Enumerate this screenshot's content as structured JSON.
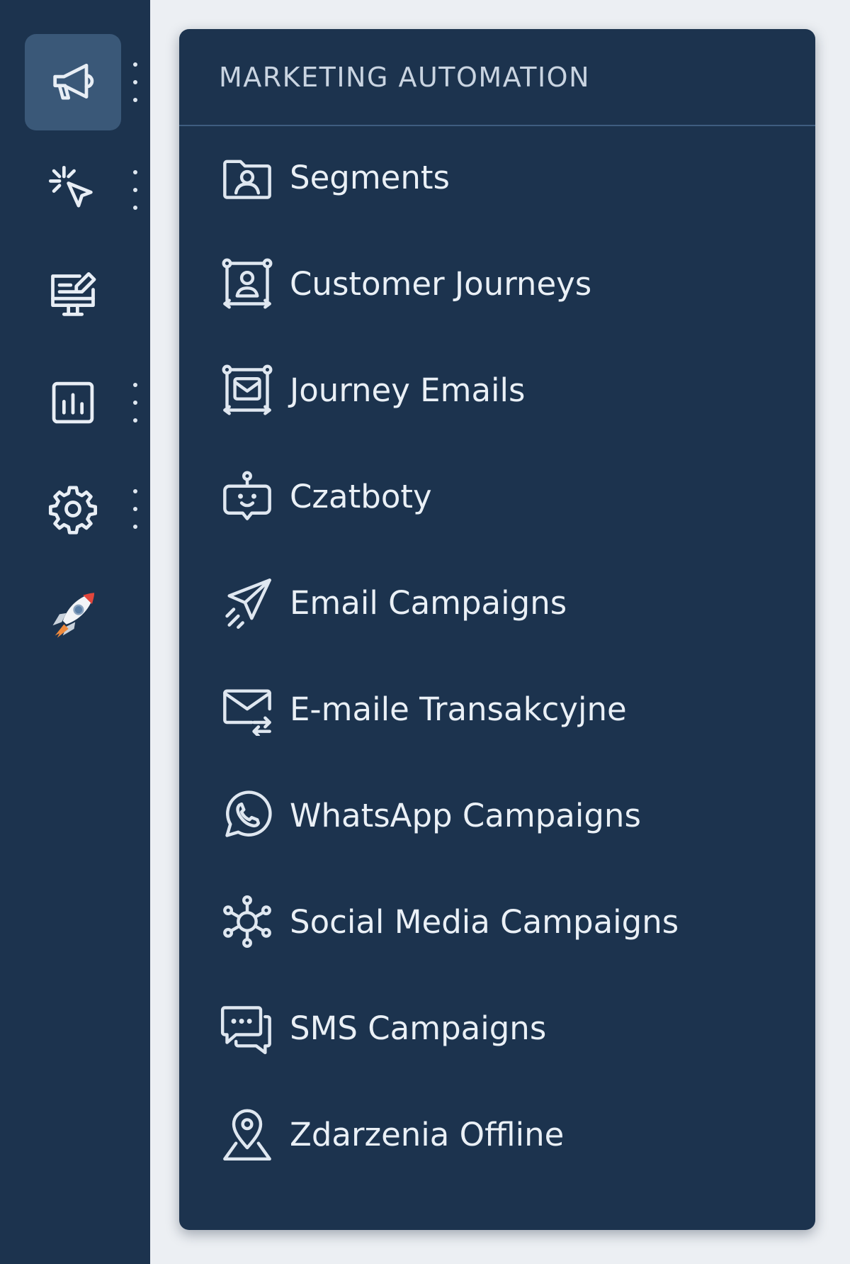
{
  "rail": {
    "items": [
      {
        "icon": "megaphone-icon",
        "active": true,
        "has_kebab": true
      },
      {
        "icon": "click-cursor-icon",
        "active": false,
        "has_kebab": true
      },
      {
        "icon": "monitor-edit-icon",
        "active": false,
        "has_kebab": false
      },
      {
        "icon": "bar-chart-icon",
        "active": false,
        "has_kebab": true
      },
      {
        "icon": "gear-icon",
        "active": false,
        "has_kebab": true
      },
      {
        "icon": "rocket-icon",
        "active": false,
        "has_kebab": false
      }
    ]
  },
  "panel": {
    "title": "MARKETING AUTOMATION",
    "items": [
      {
        "label": "Segments",
        "icon": "user-folder-icon"
      },
      {
        "label": "Customer Journeys",
        "icon": "user-journey-icon"
      },
      {
        "label": "Journey Emails",
        "icon": "journey-email-icon"
      },
      {
        "label": "Czatboty",
        "icon": "chatbot-icon"
      },
      {
        "label": "Email Campaigns",
        "icon": "paper-plane-icon"
      },
      {
        "label": "E-maile Transakcyjne",
        "icon": "envelope-transfer-icon"
      },
      {
        "label": "WhatsApp Campaigns",
        "icon": "whatsapp-icon"
      },
      {
        "label": "Social Media Campaigns",
        "icon": "network-icon"
      },
      {
        "label": "SMS Campaigns",
        "icon": "chat-bubbles-icon"
      },
      {
        "label": "Zdarzenia Offline",
        "icon": "location-pin-icon"
      }
    ]
  },
  "colors": {
    "sidebar_bg": "#1c334e",
    "active_bg": "#3a5878",
    "text": "#eaf0f6",
    "header_text": "#c9d4e1",
    "divider": "#3f5d80",
    "page_bg": "#eceff3",
    "rocket_accent": "#e2463c"
  }
}
